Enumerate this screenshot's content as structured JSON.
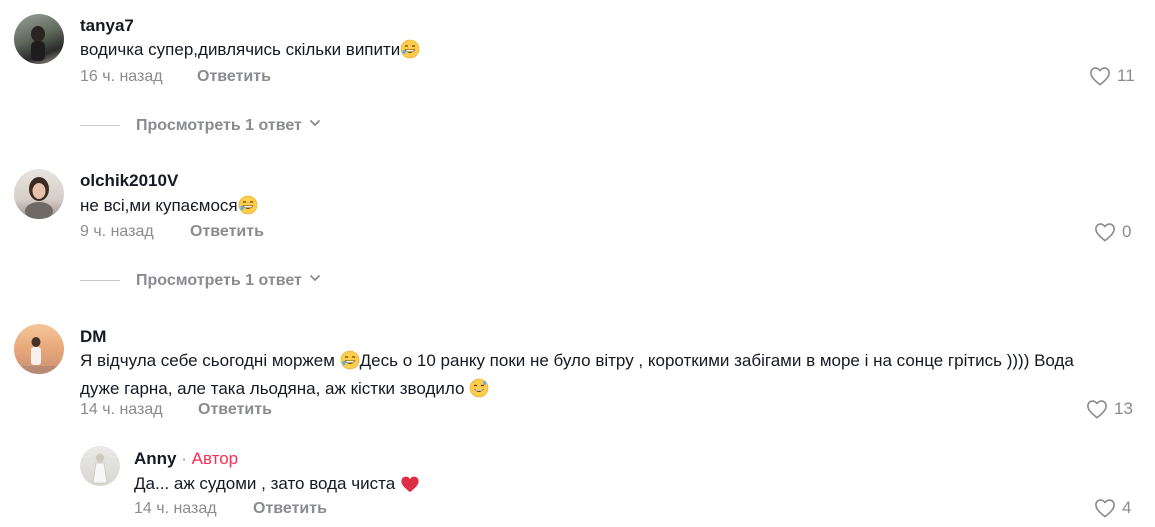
{
  "comments": [
    {
      "username": "tanya7",
      "text": "водичка супер,дивлячись скільки випити",
      "time": "16 ч. назад",
      "reply_label": "Ответить",
      "likes": "11",
      "view_replies": "Просмотреть 1 ответ"
    },
    {
      "username": "olchik2010V",
      "text": "не всі,ми купаємося",
      "time": "9 ч. назад",
      "reply_label": "Ответить",
      "likes": "0",
      "view_replies": "Просмотреть 1 ответ"
    },
    {
      "username": "DM",
      "text_part1": "Я відчула себе сьогодні моржем ",
      "text_part2": "Десь о 10 ранку поки не було вітру , короткими забігами в море і на сонце грітись )))) Вода",
      "text_line2": "дуже гарна, але така льодяна, аж кістки зводило ",
      "time": "14 ч. назад",
      "reply_label": "Ответить",
      "likes": "13"
    }
  ],
  "reply": {
    "username": "Anny",
    "separator": " · ",
    "author_label": "Автор",
    "text": "Да... аж судоми , зато вода чиста ",
    "time": "14 ч. назад",
    "reply_label": "Ответить",
    "likes": "4"
  },
  "icons": {
    "like": "heart-outline-icon",
    "chevron": "chevron-down-icon",
    "laugh_emoji": "grinning-sweat-emoji",
    "red_heart": "red-heart-emoji"
  },
  "colors": {
    "author": "#fe2c55",
    "muted": "#8a8b91",
    "text": "#161823"
  }
}
